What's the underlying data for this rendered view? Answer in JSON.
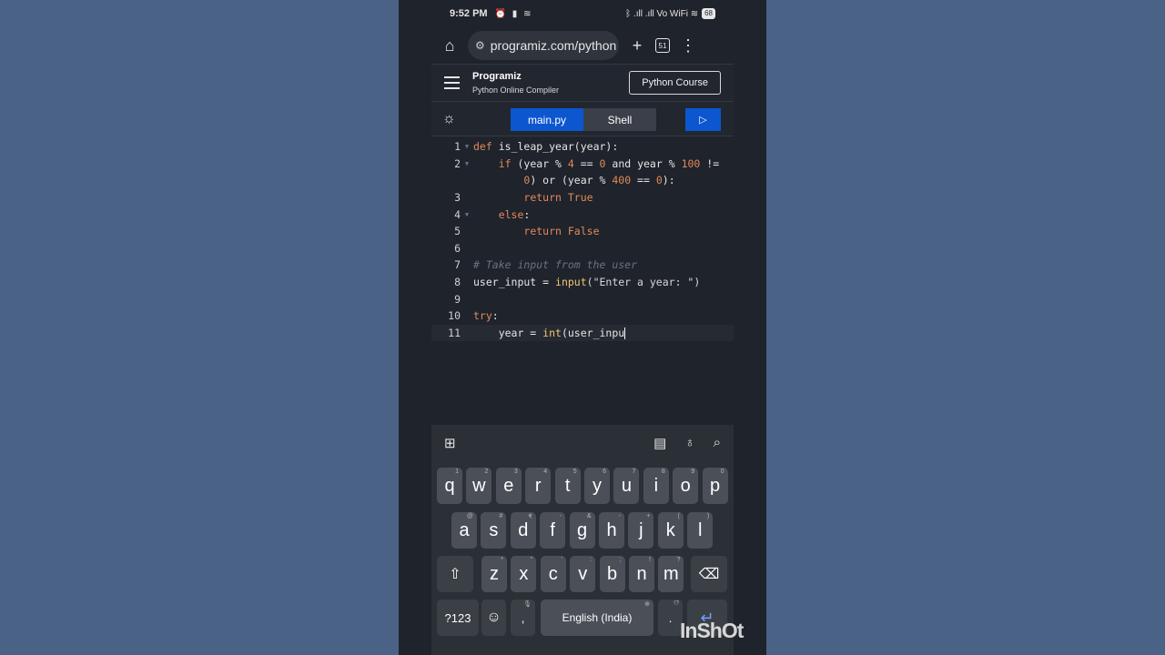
{
  "status_bar": {
    "time": "9:52 PM",
    "icons": "⏰ ▮ ≋",
    "net": "ᛒ .ıll .ıll Vo WiFi ≋",
    "battery": "68"
  },
  "browser": {
    "url": "programiz.com/python"
  },
  "site": {
    "logo": "Programiz",
    "subtitle": "Python Online Compiler",
    "course_button": "Python Course"
  },
  "editor": {
    "tabs": [
      "main.py",
      "Shell"
    ],
    "active_tab": "main.py",
    "lines": [
      {
        "n": "1",
        "fold": true
      },
      {
        "n": "2",
        "fold": true
      },
      {
        "n": "",
        "fold": false
      },
      {
        "n": "3",
        "fold": false
      },
      {
        "n": "4",
        "fold": true
      },
      {
        "n": "5",
        "fold": false
      },
      {
        "n": "6",
        "fold": false
      },
      {
        "n": "7",
        "fold": false
      },
      {
        "n": "8",
        "fold": false
      },
      {
        "n": "9",
        "fold": false
      },
      {
        "n": "10",
        "fold": false
      },
      {
        "n": "11",
        "fold": false
      }
    ],
    "code": {
      "l1": "is_leap_year(year):",
      "l2a": "(year % ",
      "l2b": "4",
      "l2c": " == ",
      "l2d": "0",
      "l2e": " and year % ",
      "l2f": "100",
      "l2g": " !=",
      "l3a": "0",
      "l3b": ") or (year % ",
      "l3c": "400",
      "l3d": " == ",
      "l3e": "0",
      "l3f": "):",
      "l4": "True",
      "l6": "False",
      "l8": "# Take input from the user",
      "l9a": "user_input = ",
      "l9b": "input",
      "l9c": "(\"Enter a year: \")",
      "l11a": "    year = ",
      "l11b": "int",
      "l11c": "(user_inpu"
    }
  },
  "keyboard": {
    "row1": [
      [
        "q",
        "1"
      ],
      [
        "w",
        "2"
      ],
      [
        "e",
        "3"
      ],
      [
        "r",
        "4"
      ],
      [
        "t",
        "5"
      ],
      [
        "y",
        "6"
      ],
      [
        "u",
        "7"
      ],
      [
        "i",
        "8"
      ],
      [
        "o",
        "9"
      ],
      [
        "p",
        "0"
      ]
    ],
    "row2": [
      [
        "a",
        "@"
      ],
      [
        "s",
        "#"
      ],
      [
        "d",
        "₹"
      ],
      [
        "f",
        "-"
      ],
      [
        "g",
        "&"
      ],
      [
        "h",
        "-"
      ],
      [
        "j",
        "+"
      ],
      [
        "k",
        "("
      ],
      [
        "l",
        ")"
      ]
    ],
    "row3": [
      [
        "z",
        "*"
      ],
      [
        "x",
        "\""
      ],
      [
        "c",
        "'"
      ],
      [
        "v",
        ":"
      ],
      [
        "b",
        ";"
      ],
      [
        "n",
        "!"
      ],
      [
        "m",
        "?"
      ]
    ],
    "symbols_label": "?123",
    "space_label": "English (India)",
    "comma": ",",
    "period": "."
  },
  "watermark": "InShOt"
}
